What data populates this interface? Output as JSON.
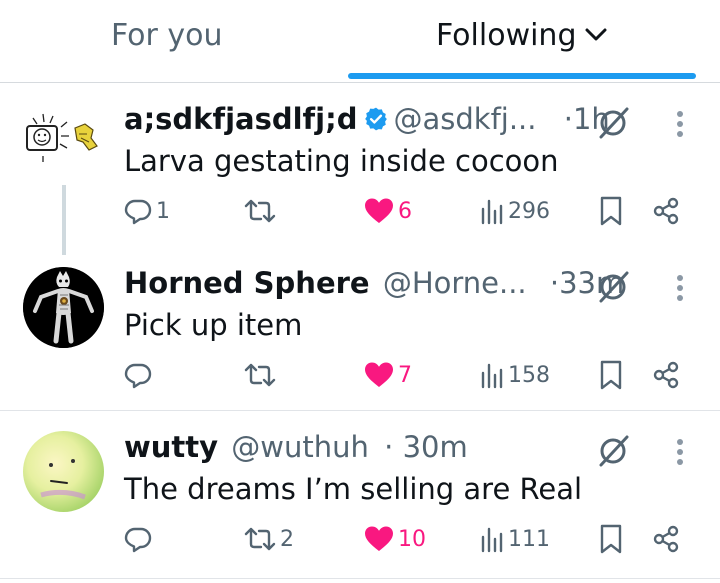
{
  "tabs": {
    "for_you": "For you",
    "following": "Following"
  },
  "colors": {
    "accent": "#1d9bf0",
    "like": "#f91880",
    "muted": "#536471",
    "verified": "#1d9bf0"
  },
  "tweets": [
    {
      "name": "a;sdkfjasdlfj;d",
      "verified": true,
      "handle": "@asdkfj...",
      "dot": "·",
      "time": "1h",
      "text": "Larva gestating inside cocoon",
      "replies": "1",
      "retweets": "",
      "likes": "6",
      "views": "296"
    },
    {
      "name": "Horned Sphere",
      "verified": false,
      "handle": "@Horne...",
      "dot": "·",
      "time": "33m",
      "text": "Pick up item",
      "replies": "",
      "retweets": "",
      "likes": "7",
      "views": "158"
    },
    {
      "name": "wutty",
      "verified": false,
      "handle": "@wuthuh",
      "dot": "·",
      "time": "30m",
      "text": "The dreams I’m selling are Real",
      "replies": "",
      "retweets": "2",
      "likes": "10",
      "views": "111"
    }
  ]
}
